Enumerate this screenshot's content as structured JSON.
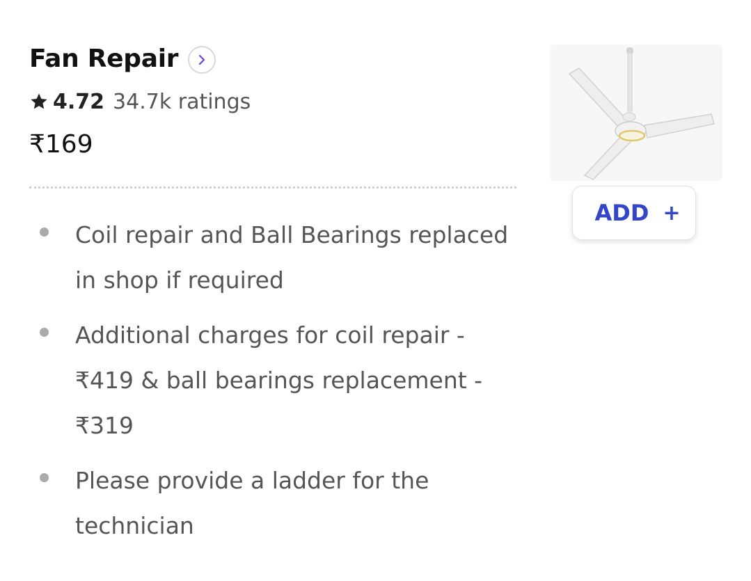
{
  "service": {
    "title": "Fan Repair",
    "rating": "4.72",
    "rating_count": "34.7k ratings",
    "price": "₹169"
  },
  "details": [
    {
      "text": "Coil repair and Ball Bearings replaced in shop if required"
    },
    {
      "text": "Additional charges for coil repair - ₹419 & ball bearings replacement - ₹319"
    },
    {
      "text": "Please provide a ladder for the technician"
    }
  ],
  "actions": {
    "add_label": "ADD",
    "add_plus": "+"
  },
  "icons": {
    "details_chevron": "chevron-right-icon",
    "rating_star": "star-icon",
    "product_image": "ceiling-fan-image"
  },
  "colors": {
    "accent": "#3346c8",
    "chevron": "#6e42e5",
    "text_primary": "#111111",
    "text_secondary": "#555555",
    "bullet": "#aaaaaa"
  }
}
